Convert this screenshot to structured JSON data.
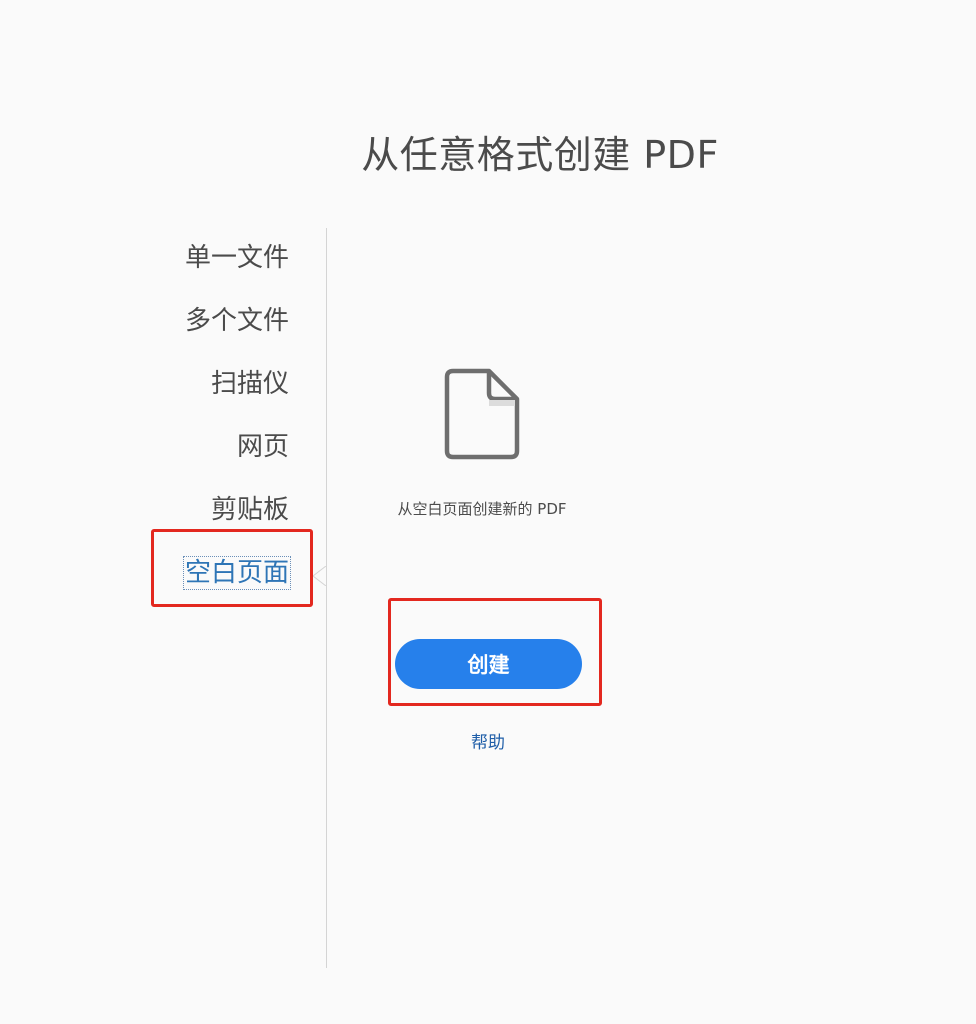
{
  "page": {
    "title": "从任意格式创建 PDF"
  },
  "sidebar": {
    "items": [
      {
        "label": "单一文件",
        "active": false
      },
      {
        "label": "多个文件",
        "active": false
      },
      {
        "label": "扫描仪",
        "active": false
      },
      {
        "label": "网页",
        "active": false
      },
      {
        "label": "剪贴板",
        "active": false
      },
      {
        "label": "空白页面",
        "active": true
      }
    ]
  },
  "main": {
    "icon": "blank-document-icon",
    "description": "从空白页面创建新的 PDF",
    "create_label": "创建",
    "help_label": "帮助"
  },
  "colors": {
    "background": "#fafafa",
    "accent": "#2680eb",
    "active_text": "#2e75b6",
    "link": "#1f5ea8",
    "annotation": "#e3281f"
  }
}
